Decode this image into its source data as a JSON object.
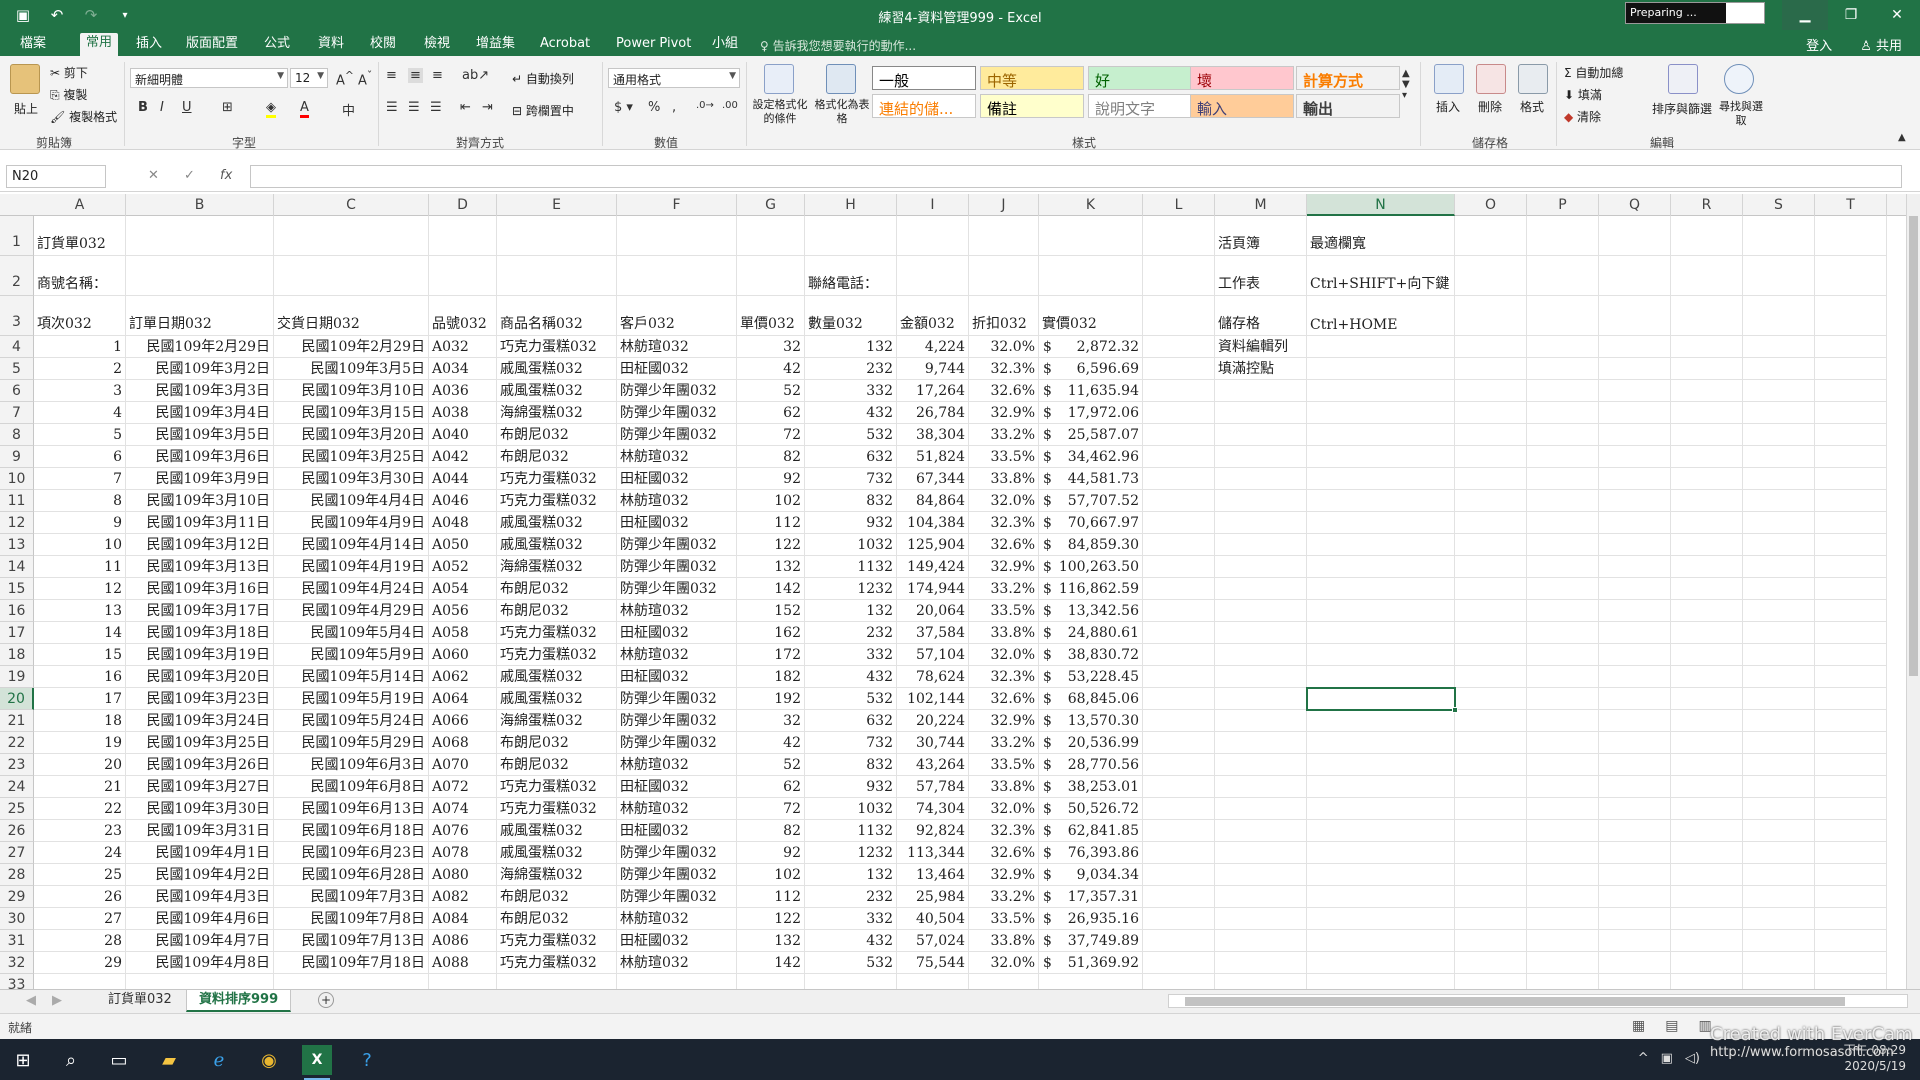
{
  "window": {
    "title": "練習4-資料管理999 - Excel",
    "preparing": "Preparing ..."
  },
  "ribbon_tabs": [
    "檔案",
    "常用",
    "插入",
    "版面配置",
    "公式",
    "資料",
    "校閱",
    "檢視",
    "增益集",
    "Acrobat",
    "Power Pivot",
    "小組"
  ],
  "active_tab": "常用",
  "tell_me": "告訴我您想要執行的動作...",
  "account": {
    "signin": "登入",
    "share": "共用"
  },
  "ribbon": {
    "clipboard": {
      "paste": "貼上",
      "cut": "剪下",
      "copy": "複製",
      "format_painter": "複製格式",
      "label": "剪貼簿"
    },
    "font": {
      "name": "新細明體",
      "size": "12",
      "label": "字型"
    },
    "alignment": {
      "wrap": "自動換列",
      "merge": "跨欄置中",
      "label": "對齊方式"
    },
    "number": {
      "format": "通用格式",
      "label": "數值"
    },
    "styles": {
      "conditional": "設定格式化的條件",
      "as_table": "格式化為表格",
      "cells": [
        {
          "text": "一般",
          "bg": "#ffffff",
          "fg": "#000000",
          "bold": false
        },
        {
          "text": "中等",
          "bg": "#ffeb9c",
          "fg": "#9c6500",
          "bold": false
        },
        {
          "text": "好",
          "bg": "#c6efce",
          "fg": "#006100",
          "bold": false
        },
        {
          "text": "壞",
          "bg": "#ffc7ce",
          "fg": "#9c0006",
          "bold": false
        },
        {
          "text": "計算方式",
          "bg": "#f2f2f2",
          "fg": "#fa7d00",
          "bold": true
        },
        {
          "text": "連結的儲...",
          "bg": "#ffffff",
          "fg": "#fa7d00",
          "bold": false
        },
        {
          "text": "備註",
          "bg": "#ffffcc",
          "fg": "#000000",
          "bold": false
        },
        {
          "text": "說明文字",
          "bg": "#ffffff",
          "fg": "#7f7f7f",
          "bold": false
        },
        {
          "text": "輸入",
          "bg": "#ffcc99",
          "fg": "#3f3f76",
          "bold": false
        },
        {
          "text": "輸出",
          "bg": "#f2f2f2",
          "fg": "#3f3f3f",
          "bold": true
        }
      ],
      "label": "樣式"
    },
    "cells": {
      "insert": "插入",
      "delete": "刪除",
      "format": "格式",
      "label": "儲存格"
    },
    "editing": {
      "autosum": "自動加總",
      "fill": "填滿",
      "clear": "清除",
      "sort": "排序與篩選",
      "find": "尋找與選取",
      "label": "編輯"
    }
  },
  "formula_bar": {
    "name_box": "N20",
    "content": ""
  },
  "columns": [
    "A",
    "B",
    "C",
    "D",
    "E",
    "F",
    "G",
    "H",
    "I",
    "J",
    "K",
    "L",
    "M",
    "N",
    "O",
    "P",
    "Q",
    "R",
    "S",
    "T"
  ],
  "selected_col": "N",
  "selected_row": 20,
  "header_rows": {
    "r1": {
      "A": "訂貨單032",
      "M": "活頁簿",
      "N": "最適欄寬"
    },
    "r2": {
      "A": "商號名稱：",
      "H": "聯絡電話：",
      "M": "工作表",
      "N": "Ctrl+SHIFT+向下鍵"
    },
    "r3": {
      "A": "項次032",
      "B": "訂單日期032",
      "C": "交貨日期032",
      "D": "品號032",
      "E": "商品名稱032",
      "F": "客戶032",
      "G": "單價032",
      "H": "數量032",
      "I": "金額032",
      "J": "折扣032",
      "K": "實價032",
      "M": "儲存格",
      "N": "Ctrl+HOME"
    },
    "r4": {
      "M": "資料編輯列"
    },
    "r5": {
      "M": "填滿控點"
    }
  },
  "currency_symbol": "$",
  "data_rows": [
    [
      "1",
      "民國109年2月29日",
      "民國109年2月29日",
      "A032",
      "巧克力蛋糕032",
      "林舫瑄032",
      "32",
      "132",
      "4,224",
      "32.0%",
      "2,872.32"
    ],
    [
      "2",
      "民國109年3月2日",
      "民國109年3月5日",
      "A034",
      "戚風蛋糕032",
      "田柾國032",
      "42",
      "232",
      "9,744",
      "32.3%",
      "6,596.69"
    ],
    [
      "3",
      "民國109年3月3日",
      "民國109年3月10日",
      "A036",
      "戚風蛋糕032",
      "防彈少年團032",
      "52",
      "332",
      "17,264",
      "32.6%",
      "11,635.94"
    ],
    [
      "4",
      "民國109年3月4日",
      "民國109年3月15日",
      "A038",
      "海綿蛋糕032",
      "防彈少年團032",
      "62",
      "432",
      "26,784",
      "32.9%",
      "17,972.06"
    ],
    [
      "5",
      "民國109年3月5日",
      "民國109年3月20日",
      "A040",
      "布朗尼032",
      "防彈少年團032",
      "72",
      "532",
      "38,304",
      "33.2%",
      "25,587.07"
    ],
    [
      "6",
      "民國109年3月6日",
      "民國109年3月25日",
      "A042",
      "布朗尼032",
      "林舫瑄032",
      "82",
      "632",
      "51,824",
      "33.5%",
      "34,462.96"
    ],
    [
      "7",
      "民國109年3月9日",
      "民國109年3月30日",
      "A044",
      "巧克力蛋糕032",
      "田柾國032",
      "92",
      "732",
      "67,344",
      "33.8%",
      "44,581.73"
    ],
    [
      "8",
      "民國109年3月10日",
      "民國109年4月4日",
      "A046",
      "巧克力蛋糕032",
      "林舫瑄032",
      "102",
      "832",
      "84,864",
      "32.0%",
      "57,707.52"
    ],
    [
      "9",
      "民國109年3月11日",
      "民國109年4月9日",
      "A048",
      "戚風蛋糕032",
      "田柾國032",
      "112",
      "932",
      "104,384",
      "32.3%",
      "70,667.97"
    ],
    [
      "10",
      "民國109年3月12日",
      "民國109年4月14日",
      "A050",
      "戚風蛋糕032",
      "防彈少年團032",
      "122",
      "1032",
      "125,904",
      "32.6%",
      "84,859.30"
    ],
    [
      "11",
      "民國109年3月13日",
      "民國109年4月19日",
      "A052",
      "海綿蛋糕032",
      "防彈少年團032",
      "132",
      "1132",
      "149,424",
      "32.9%",
      "100,263.50"
    ],
    [
      "12",
      "民國109年3月16日",
      "民國109年4月24日",
      "A054",
      "布朗尼032",
      "防彈少年團032",
      "142",
      "1232",
      "174,944",
      "33.2%",
      "116,862.59"
    ],
    [
      "13",
      "民國109年3月17日",
      "民國109年4月29日",
      "A056",
      "布朗尼032",
      "林舫瑄032",
      "152",
      "132",
      "20,064",
      "33.5%",
      "13,342.56"
    ],
    [
      "14",
      "民國109年3月18日",
      "民國109年5月4日",
      "A058",
      "巧克力蛋糕032",
      "田柾國032",
      "162",
      "232",
      "37,584",
      "33.8%",
      "24,880.61"
    ],
    [
      "15",
      "民國109年3月19日",
      "民國109年5月9日",
      "A060",
      "巧克力蛋糕032",
      "林舫瑄032",
      "172",
      "332",
      "57,104",
      "32.0%",
      "38,830.72"
    ],
    [
      "16",
      "民國109年3月20日",
      "民國109年5月14日",
      "A062",
      "戚風蛋糕032",
      "田柾國032",
      "182",
      "432",
      "78,624",
      "32.3%",
      "53,228.45"
    ],
    [
      "17",
      "民國109年3月23日",
      "民國109年5月19日",
      "A064",
      "戚風蛋糕032",
      "防彈少年團032",
      "192",
      "532",
      "102,144",
      "32.6%",
      "68,845.06"
    ],
    [
      "18",
      "民國109年3月24日",
      "民國109年5月24日",
      "A066",
      "海綿蛋糕032",
      "防彈少年團032",
      "32",
      "632",
      "20,224",
      "32.9%",
      "13,570.30"
    ],
    [
      "19",
      "民國109年3月25日",
      "民國109年5月29日",
      "A068",
      "布朗尼032",
      "防彈少年團032",
      "42",
      "732",
      "30,744",
      "33.2%",
      "20,536.99"
    ],
    [
      "20",
      "民國109年3月26日",
      "民國109年6月3日",
      "A070",
      "布朗尼032",
      "林舫瑄032",
      "52",
      "832",
      "43,264",
      "33.5%",
      "28,770.56"
    ],
    [
      "21",
      "民國109年3月27日",
      "民國109年6月8日",
      "A072",
      "巧克力蛋糕032",
      "田柾國032",
      "62",
      "932",
      "57,784",
      "33.8%",
      "38,253.01"
    ],
    [
      "22",
      "民國109年3月30日",
      "民國109年6月13日",
      "A074",
      "巧克力蛋糕032",
      "林舫瑄032",
      "72",
      "1032",
      "74,304",
      "32.0%",
      "50,526.72"
    ],
    [
      "23",
      "民國109年3月31日",
      "民國109年6月18日",
      "A076",
      "戚風蛋糕032",
      "田柾國032",
      "82",
      "1132",
      "92,824",
      "32.3%",
      "62,841.85"
    ],
    [
      "24",
      "民國109年4月1日",
      "民國109年6月23日",
      "A078",
      "戚風蛋糕032",
      "防彈少年團032",
      "92",
      "1232",
      "113,344",
      "32.6%",
      "76,393.86"
    ],
    [
      "25",
      "民國109年4月2日",
      "民國109年6月28日",
      "A080",
      "海綿蛋糕032",
      "防彈少年團032",
      "102",
      "132",
      "13,464",
      "32.9%",
      "9,034.34"
    ],
    [
      "26",
      "民國109年4月3日",
      "民國109年7月3日",
      "A082",
      "布朗尼032",
      "防彈少年團032",
      "112",
      "232",
      "25,984",
      "33.2%",
      "17,357.31"
    ],
    [
      "27",
      "民國109年4月6日",
      "民國109年7月8日",
      "A084",
      "布朗尼032",
      "林舫瑄032",
      "122",
      "332",
      "40,504",
      "33.5%",
      "26,935.16"
    ],
    [
      "28",
      "民國109年4月7日",
      "民國109年7月13日",
      "A086",
      "巧克力蛋糕032",
      "田柾國032",
      "132",
      "432",
      "57,024",
      "33.8%",
      "37,749.89"
    ],
    [
      "29",
      "民國109年4月8日",
      "民國109年7月18日",
      "A088",
      "巧克力蛋糕032",
      "林舫瑄032",
      "142",
      "532",
      "75,544",
      "32.0%",
      "51,369.92"
    ]
  ],
  "sheet_tabs": [
    "訂貨單032",
    "資料排序999"
  ],
  "active_sheet": "資料排序999",
  "status": "就緒",
  "taskbar": {
    "time": "下午 08:29",
    "date": "2020/5/19"
  },
  "watermark": {
    "line1": "Created with EverCam",
    "line2": "http://www.formosasoft.com"
  }
}
